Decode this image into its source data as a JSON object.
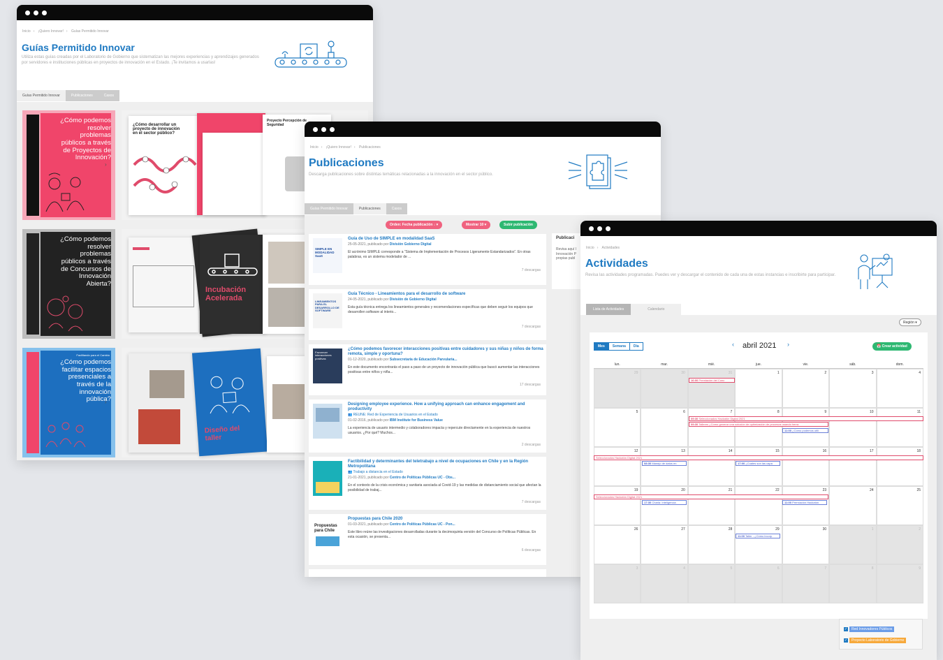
{
  "w1": {
    "breadcrumbs": [
      "Inicio",
      "¡Quiero Innovar!",
      "Guías Permitido Innovar"
    ],
    "title": "Guías Permitido Innovar",
    "description": "Utiliza estas guías creadas por el Laboratorio de Gobierno que sistematizan las mejores experiencias y aprendizajes generados por servidores e instituciones públicas en proyectos de innovación en el Estado. ¡Te invitamos a usarlas!",
    "tabs": [
      "Guías Permitido Innovar",
      "Publicaciones",
      "Casos"
    ],
    "covers": [
      {
        "text": "¿Cómo podemos resolver problemas públicos a través de Proyectos de Innovación?",
        "color": "#f0456a",
        "side": "#111111"
      },
      {
        "text": "¿Cómo podemos resolver problemas públicos a través de Concursos de Innovación Abierta?",
        "color": "#222222",
        "side": "#222222"
      },
      {
        "text": "¿Cómo podemos facilitar espacios presenciales a través de la innovación pública?",
        "color": "#1d6fbf",
        "side": "#f0456a",
        "kicker": "Facilitando para el Cambio"
      }
    ],
    "spread_texts": [
      "¿Cómo desarrollar un proyecto de innovación en el sector público?",
      "Proyecto Percepción de Seguridad",
      "Incubación Acelerada",
      "Diseño del taller"
    ]
  },
  "w2": {
    "breadcrumbs": [
      "Inicio",
      "¡Quiero Innovar!",
      "Publicaciones"
    ],
    "title": "Publicaciones",
    "description": "Descarga publicaciones sobre distintas temáticas relacionadas a la innovación en el sector público.",
    "tabs": [
      "Guías Permitido Innovar",
      "Publicaciones",
      "Casos"
    ],
    "order_button": "Orden: Fecha publicación ↓ ▾",
    "show_button": "Mostrar 10 ▾",
    "upload_button": "Subir publicación",
    "side_title": "Publicaci",
    "side_text": "Revisa aquí l Innovación P propias publ",
    "items": [
      {
        "title": "Guía de Uso de SIMPLE en modalidad SaaS",
        "date": "25-05-2021, publicado por ",
        "author": "División Gobierno Digital",
        "excerpt": "El acrónimo SIMPLE corresponde a “Sistema de Implementación de Procesos Ligeramente Estandarizados”. En otras palabras, es un sistema modelador de ...",
        "downloads": "7 descargas",
        "thumb": "SIMPLE EN MODALIDAD SaaS"
      },
      {
        "title": "Guía Técnico - Lineamientos para el desarrollo de software",
        "date": "24-05-2021, publicado por ",
        "author": "División de Gobierno Digital",
        "excerpt": "Esta guía técnica entrega los lineamientos generales y recomendaciones específicas que deben seguir los equipos que desarrollen software al interio...",
        "downloads": "7 descargas",
        "thumb": "LINEAMIENTOS PARA EL DESARROLLO DE SOFTWARE"
      },
      {
        "title": "¿Cómo podemos favorecer interacciones positivas entre cuidadores y sus niñas y niños de forma remota, simple y oportuna?",
        "date": "01-12-2020, publicado por ",
        "author": "Subsecretaría de Educación Parvularia...",
        "excerpt": "En este documento encontrarás el paso a paso de un proyecto de innovación pública que buscó aumentar las interacciones positivas entre niños y niña...",
        "downloads": "17 descargas",
        "thumb": "Favorecer interacciones positivas"
      },
      {
        "title": "Designing employee experience. How a unifying approach can enhance engagement and productivity",
        "tag": "👥 REUNE: Red de Experiencia de Usuarios en el Estado",
        "date": "01-02-2016, publicado por ",
        "author": "IBM Institute for Business Value",
        "excerpt": "La experiencia de usuario intermedio y colaboradores impacta y repercute directamente en la experiencia de nuestros usuarios. ¿Por qué? Muchos...",
        "downloads": "2 descargas",
        "thumb": ""
      },
      {
        "title": "Factibilidad y determinantes del teletrabajo a nivel de ocupaciones en Chile y en la Región Metropolitana",
        "tag": "👥 Trabajo a distancia en el Estado",
        "date": "21-01-2021, publicado por ",
        "author": "Centro de Políticas Públicas UC - Obs...",
        "excerpt": "En el contexto de la crisis económica y sanitaria asociada al Covid-19 y las medidas de distanciamiento social que afectan la posibilidad de trabaj...",
        "downloads": "7 descargas",
        "thumb": ""
      },
      {
        "title": "Propuestas para Chile 2020",
        "date": "01-03-2021, publicado por ",
        "author": "Centro de Políticas Públicas UC - Pon...",
        "excerpt": "Este libro reúne las investigaciones desarrolladas durante la decimoquinta versión del Concurso de Políticas Públicas. En esta ocasión, se presenta...",
        "downloads": "6 descargas",
        "thumb": "Propuestas para Chile"
      }
    ]
  },
  "w3": {
    "breadcrumbs": [
      "Inicio",
      "Actividades"
    ],
    "title": "Actividades",
    "description": "Revisa las actividades programadas. Puedes ver y descargar el contenido de cada una de estas instancias e inscribirte para participar.",
    "tabs": [
      "Lista de Actividades",
      "Calendario"
    ],
    "region_button": "Región ▾",
    "view_buttons": [
      "Mes",
      "Semana",
      "Día"
    ],
    "month_label": "abril 2021",
    "prev": "‹",
    "next": "›",
    "create_button": "📅 Crear actividad",
    "weekdays": [
      "lun.",
      "mar.",
      "mié.",
      "jue.",
      "vie.",
      "sáb.",
      "dom."
    ],
    "weeks": [
      [
        "29",
        "30",
        "31",
        "1",
        "2",
        "3",
        "4"
      ],
      [
        "5",
        "6",
        "7",
        "8",
        "9",
        "10",
        "11"
      ],
      [
        "12",
        "13",
        "14",
        "15",
        "16",
        "17",
        "18"
      ],
      [
        "19",
        "20",
        "21",
        "22",
        "23",
        "24",
        "25"
      ],
      [
        "26",
        "27",
        "28",
        "29",
        "30",
        "1",
        "2"
      ],
      [
        "3",
        "4",
        "5",
        "6",
        "7",
        "8",
        "9"
      ]
    ],
    "events": {
      "e1": {
        "time": "16:00",
        "text": " Premiación del Conc"
      },
      "e2": {
        "time": "09:30",
        "text": " Seleccionados Hackatón Digital 2021"
      },
      "e3": {
        "time": "09:30",
        "text": " Talleres ¿Cómo generar una solución de optimización de procesos usando herra"
      },
      "e4": {
        "time": "11:00",
        "text": " ¿Cómo podemos utili"
      },
      "e5": {
        "time": "",
        "text": "Seleccionados Hackatón Digital 2021"
      },
      "e6": {
        "time": "08:30",
        "text": " Manejo de datos en"
      },
      "e7": {
        "time": "17:00",
        "text": " ¿Cuáles son las capa"
      },
      "e8": {
        "time": "",
        "text": "Seleccionados Hackatón Digital 2021"
      },
      "e9": {
        "time": "17:30",
        "text": " Charla: Inteligencia"
      },
      "e10": {
        "time": "11:00",
        "text": " Premiación Hackatón"
      },
      "e11": {
        "time": "11:00",
        "text": " Taller - ¿Cómo incorp"
      }
    },
    "legend": [
      {
        "label": "Red Innovadores Públicos",
        "color": "#6a9ce8"
      },
      {
        "label": "Proyecto Laboratorio de Gobierno",
        "color": "#f7a93b"
      }
    ]
  }
}
